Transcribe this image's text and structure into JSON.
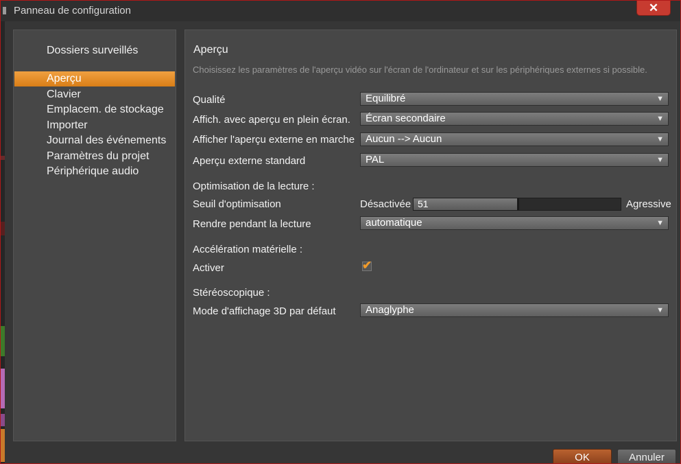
{
  "window": {
    "title": "Panneau de configuration",
    "close_glyph": "✕"
  },
  "sidebar": {
    "items": [
      {
        "label": "Dossiers surveillés"
      },
      {
        "label": "Aperçu",
        "active": true
      },
      {
        "label": "Clavier"
      },
      {
        "label": "Emplacem. de stockage"
      },
      {
        "label": "Importer"
      },
      {
        "label": "Journal des événements"
      },
      {
        "label": "Paramètres du projet"
      },
      {
        "label": "Périphérique audio"
      }
    ]
  },
  "panel": {
    "title": "Aperçu",
    "description": "Choisissez les paramètres de l'aperçu vidéo sur l'écran de l'ordinateur et sur les périphériques externes si possible.",
    "quality": {
      "label": "Qualité",
      "value": "Equilibré"
    },
    "fullscreen": {
      "label": "Affich. avec aperçu en plein écran.",
      "value": "Écran secondaire"
    },
    "external_on": {
      "label": "Afficher l'aperçu externe en marche",
      "value": "Aucun --> Aucun"
    },
    "external_standard": {
      "label": "Aperçu externe standard",
      "value": "PAL"
    },
    "playback_section": "Optimisation de la lecture :",
    "threshold": {
      "label": "Seuil d'optimisation",
      "min_label": "Désactivée",
      "max_label": "Agressive",
      "value": "51",
      "fraction": 0.5
    },
    "render": {
      "label": "Rendre pendant la lecture",
      "value": "automatique"
    },
    "hw_section": "Accélération matérielle :",
    "activate": {
      "label": "Activer",
      "checked": true,
      "check_glyph": "✔"
    },
    "stereo_section": "Stéréoscopique :",
    "mode3d": {
      "label": "Mode d'affichage 3D par défaut",
      "value": "Anaglyphe"
    },
    "dropdown_arrow": "▼"
  },
  "buttons": {
    "ok": "OK",
    "cancel": "Annuler"
  },
  "colors": {
    "accent": "#e08a22",
    "frame": "#b01818",
    "close": "#c73b30"
  }
}
